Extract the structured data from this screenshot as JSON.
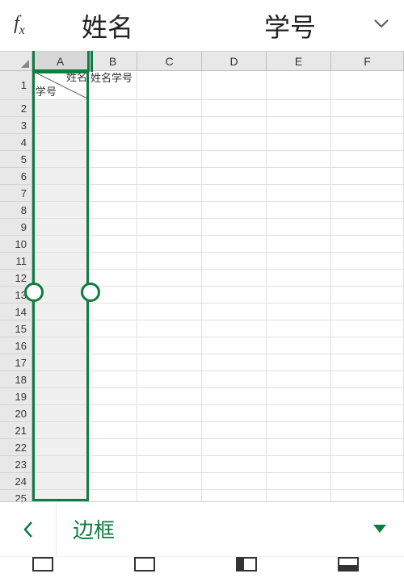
{
  "formula_bar": {
    "fx": "f",
    "fx_sub": "x",
    "part1": "姓名",
    "part2": "学号"
  },
  "columns": [
    "A",
    "B",
    "C",
    "D",
    "E",
    "F"
  ],
  "row_count": 25,
  "cells": {
    "A1_top": "姓名",
    "A1_bottom": "学号",
    "B1": "姓名学号"
  },
  "bottom_bar": {
    "back": "‹",
    "label": "边框"
  },
  "colors": {
    "accent": "#107c41"
  }
}
